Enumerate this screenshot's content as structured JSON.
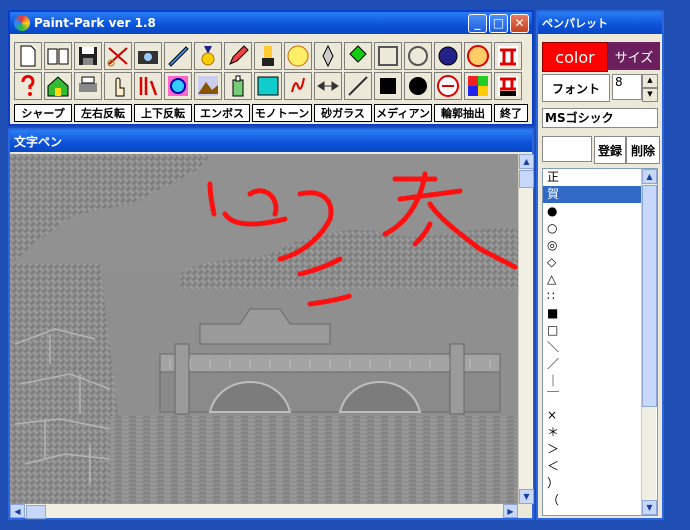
{
  "main_window": {
    "title": "Paint-Park  ver 1.8"
  },
  "filters": [
    "シャープ",
    "左右反転",
    "上下反転",
    "エンボス",
    "モノトーン",
    "砂ガラス",
    "メディアン",
    "輪郭抽出",
    "終了"
  ],
  "canvas_window": {
    "title": "文字ペン"
  },
  "palette": {
    "title": "ペンパレット",
    "color_label": "color",
    "size_label": "サイズ",
    "font_button": "フォント",
    "font_size_value": "8",
    "font_name": "MSゴシック",
    "register_button": "登録",
    "delete_button": "削除",
    "items": [
      "正",
      "賀",
      "●",
      "○",
      "◎",
      "◇",
      "△",
      "∷",
      "■",
      "□",
      "＼",
      "／",
      "｜",
      "￣",
      "×",
      "＊",
      "＞",
      "＜",
      "）",
      "（"
    ],
    "selected_index": 1
  },
  "colors": {
    "titlebar": "#0b52d9",
    "color_button": "#ff0000",
    "size_button": "#6b1f5e",
    "selection": "#3169c6"
  }
}
